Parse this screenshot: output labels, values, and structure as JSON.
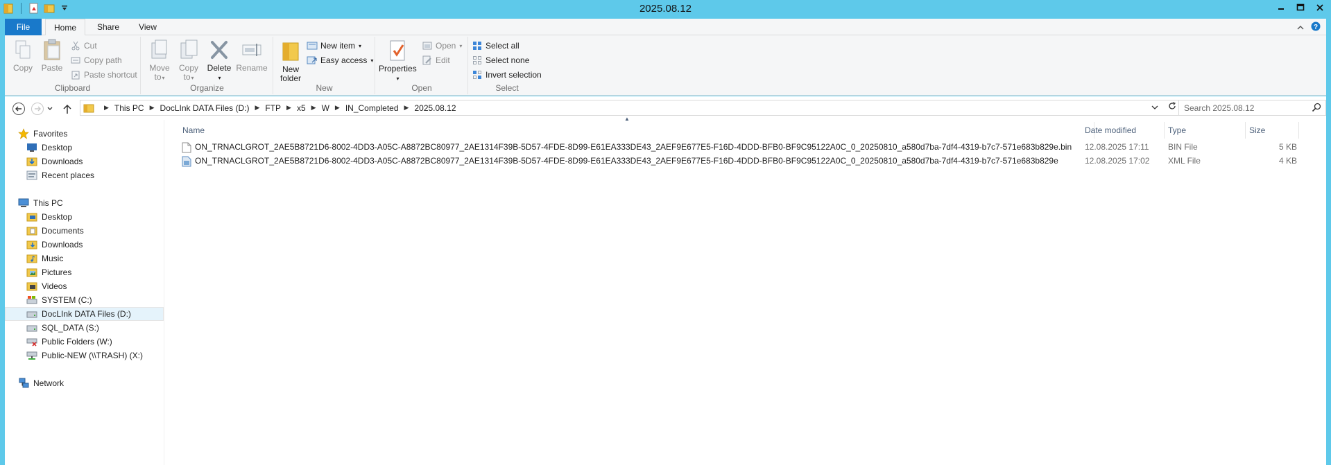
{
  "window": {
    "title": "2025.08.12"
  },
  "tabs": {
    "file": "File",
    "home": "Home",
    "share": "Share",
    "view": "View"
  },
  "ribbon": {
    "clipboard": {
      "label": "Clipboard",
      "copy": "Copy",
      "paste": "Paste",
      "cut": "Cut",
      "copy_path": "Copy path",
      "paste_shortcut": "Paste shortcut"
    },
    "organize": {
      "label": "Organize",
      "move_to_1": "Move",
      "move_to_2": "to",
      "copy_to_1": "Copy",
      "copy_to_2": "to",
      "delete": "Delete",
      "rename": "Rename"
    },
    "new": {
      "label": "New",
      "new_folder_1": "New",
      "new_folder_2": "folder",
      "new_item": "New item",
      "easy_access": "Easy access"
    },
    "open": {
      "label": "Open",
      "properties": "Properties",
      "open": "Open",
      "edit": "Edit"
    },
    "select": {
      "label": "Select",
      "select_all": "Select all",
      "select_none": "Select none",
      "invert_selection": "Invert selection"
    }
  },
  "address": {
    "crumbs": [
      "This PC",
      "DocLInk DATA Files (D:)",
      "FTP",
      "x5",
      "W",
      "IN_Completed",
      "2025.08.12"
    ]
  },
  "search": {
    "placeholder": "Search 2025.08.12"
  },
  "nav": {
    "favorites": "Favorites",
    "fav_items": [
      "Desktop",
      "Downloads",
      "Recent places"
    ],
    "this_pc": "This PC",
    "pc_items": [
      "Desktop",
      "Documents",
      "Downloads",
      "Music",
      "Pictures",
      "Videos",
      "SYSTEM (C:)",
      "DocLInk DATA Files (D:)",
      "SQL_DATA (S:)",
      "Public Folders (W:)",
      "Public-NEW (\\\\TRASH) (X:)"
    ],
    "network": "Network"
  },
  "columns": {
    "name": "Name",
    "date": "Date modified",
    "type": "Type",
    "size": "Size"
  },
  "files": [
    {
      "name": "ON_TRNACLGROT_2AE5B8721D6-8002-4DD3-A05C-A8872BC80977_2AE1314F39B-5D57-4FDE-8D99-E61EA333DE43_2AEF9E677E5-F16D-4DDD-BFB0-BF9C95122A0C_0_20250810_a580d7ba-7df4-4319-b7c7-571e683b829e.bin",
      "date": "12.08.2025 17:11",
      "type": "BIN File",
      "size": "5 KB"
    },
    {
      "name": "ON_TRNACLGROT_2AE5B8721D6-8002-4DD3-A05C-A8872BC80977_2AE1314F39B-5D57-4FDE-8D99-E61EA333DE43_2AEF9E677E5-F16D-4DDD-BFB0-BF9C95122A0C_0_20250810_a580d7ba-7df4-4319-b7c7-571e683b829e",
      "date": "12.08.2025 17:02",
      "type": "XML File",
      "size": "4 KB"
    }
  ],
  "colors": {
    "frame": "#5ec9ea",
    "file_tab": "#1979ca",
    "ribbon_bg": "#f5f6f7",
    "selected_nav": "#e5f3fb"
  }
}
